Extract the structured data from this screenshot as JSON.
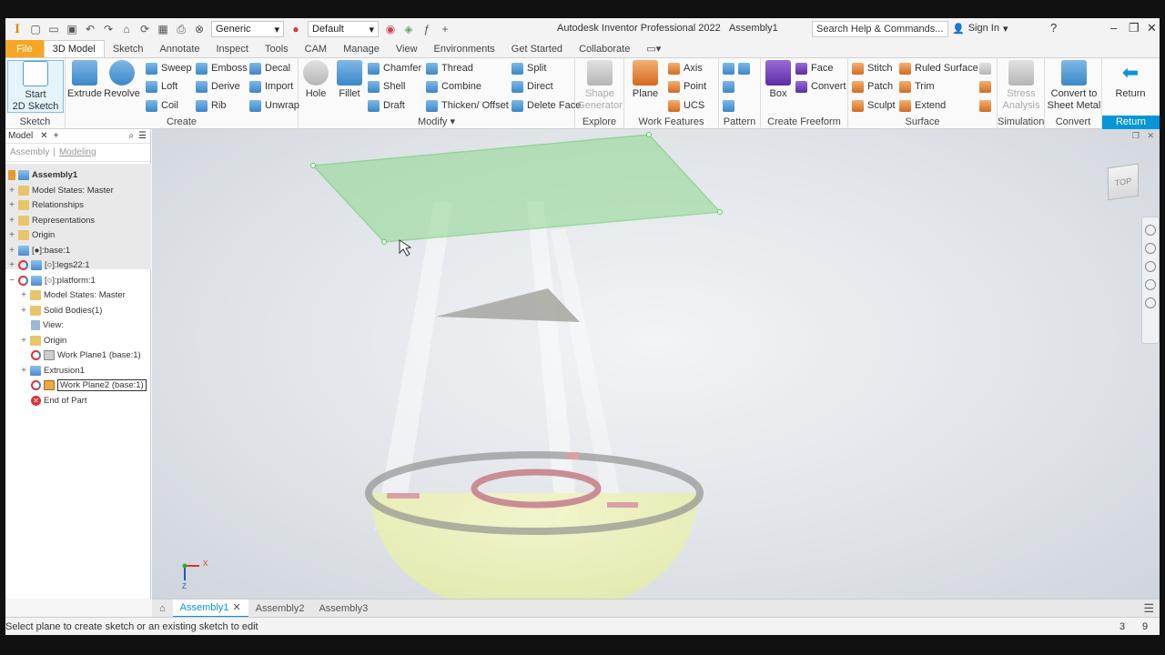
{
  "app": {
    "title": "Autodesk Inventor Professional 2022",
    "document": "Assembly1",
    "search_placeholder": "Search Help & Commands...",
    "sign_in": "Sign In",
    "material_dd": "Generic",
    "appearance_dd": "Default"
  },
  "tabs": [
    "File",
    "3D Model",
    "Sketch",
    "Annotate",
    "Inspect",
    "Tools",
    "CAM",
    "Manage",
    "View",
    "Environments",
    "Get Started",
    "Collaborate"
  ],
  "ribbon": {
    "sketch": {
      "start": "Start",
      "start2": "2D Sketch",
      "title": "Sketch"
    },
    "create": {
      "extrude": "Extrude",
      "revolve": "Revolve",
      "sweep": "Sweep",
      "emboss": "Emboss",
      "decal": "Decal",
      "loft": "Loft",
      "derive": "Derive",
      "import": "Import",
      "coil": "Coil",
      "rib": "Rib",
      "unwrap": "Unwrap",
      "title": "Create"
    },
    "modify": {
      "hole": "Hole",
      "fillet": "Fillet",
      "chamfer": "Chamfer",
      "thread": "Thread",
      "split": "Split",
      "shell": "Shell",
      "combine": "Combine",
      "direct": "Direct",
      "draft": "Draft",
      "thicken": "Thicken/ Offset",
      "delete_face": "Delete Face",
      "title": "Modify"
    },
    "explore": {
      "shape": "Shape",
      "generator": "Generator",
      "title": "Explore"
    },
    "work": {
      "plane": "Plane",
      "axis": "Axis",
      "point": "Point",
      "ucs": "UCS",
      "title": "Work Features"
    },
    "pattern": {
      "title": "Pattern"
    },
    "freeform": {
      "box": "Box",
      "face": "Face",
      "convert": "Convert",
      "title": "Create Freeform"
    },
    "surface": {
      "stitch": "Stitch",
      "ruled": "Ruled Surface",
      "patch": "Patch",
      "trim": "Trim",
      "sculpt": "Sculpt",
      "extend": "Extend",
      "title": "Surface"
    },
    "simulation": {
      "stress": "Stress",
      "analysis": "Analysis",
      "title": "Simulation"
    },
    "convert": {
      "label1": "Convert to",
      "label2": "Sheet Metal",
      "title": "Convert"
    },
    "return": {
      "label": "Return",
      "title": "Return"
    }
  },
  "browser": {
    "header": "Model",
    "sub_assembly": "Assembly",
    "sub_modeling": "Modeling",
    "tree": [
      "Assembly1",
      "Model States: Master",
      "Relationships",
      "Representations",
      "Origin",
      "[●]:base:1",
      "[○]:legs22:1",
      "[○]:platform:1",
      "Model States: Master",
      "Solid Bodies(1)",
      "View:",
      "Origin",
      "Work Plane1 (base:1)",
      "Extrusion1",
      "Work Plane2 (base:1)",
      "End of Part"
    ]
  },
  "viewcube": "TOP",
  "axis_labels": {
    "x": "X",
    "z": "Z"
  },
  "doc_tabs": [
    "Assembly1",
    "Assembly2",
    "Assembly3"
  ],
  "status": {
    "prompt": "Select plane to create sketch or an existing sketch to edit",
    "n1": "3",
    "n2": "9"
  },
  "colors": {
    "accent": "#0696d7",
    "file_tab": "#f6a623",
    "plane": "#8fd88f"
  }
}
